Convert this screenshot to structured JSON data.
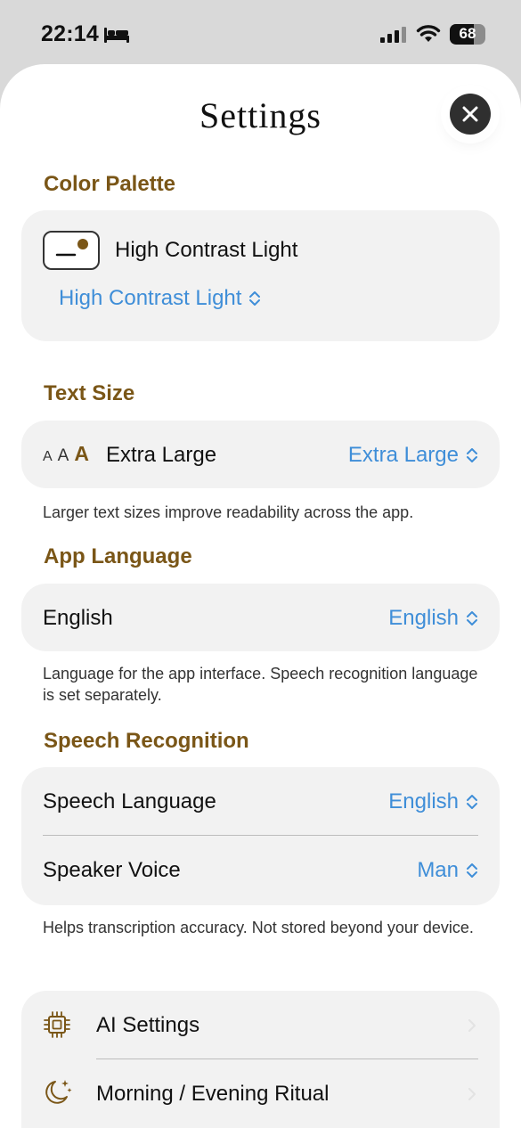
{
  "status_bar": {
    "time": "22:14",
    "battery": "68",
    "battery_level": 0.68
  },
  "sheet": {
    "title": "Settings"
  },
  "color_palette": {
    "header": "Color Palette",
    "current_label": "High Contrast Light",
    "picker_value": "High Contrast Light"
  },
  "text_size": {
    "header": "Text Size",
    "sample_small": "A",
    "sample_medium": "A",
    "sample_large": "A",
    "current_label": "Extra Large",
    "picker_value": "Extra Large",
    "footnote": "Larger text sizes improve readability across the app."
  },
  "app_language": {
    "header": "App Language",
    "current_label": "English",
    "picker_value": "English",
    "footnote": "Language for the app interface. Speech recognition language is set separately."
  },
  "speech_recognition": {
    "header": "Speech Recognition",
    "language_label": "Speech Language",
    "language_value": "English",
    "voice_label": "Speaker Voice",
    "voice_value": "Man",
    "footnote": "Helps transcription accuracy. Not stored beyond your device."
  },
  "nav": {
    "ai_settings": "AI Settings",
    "ritual": "Morning / Evening Ritual"
  },
  "colors": {
    "accent": "#3f8ed8",
    "section_header": "#7a5617",
    "card_background": "#f2f2f2",
    "close_button": "#2f2f2f"
  }
}
